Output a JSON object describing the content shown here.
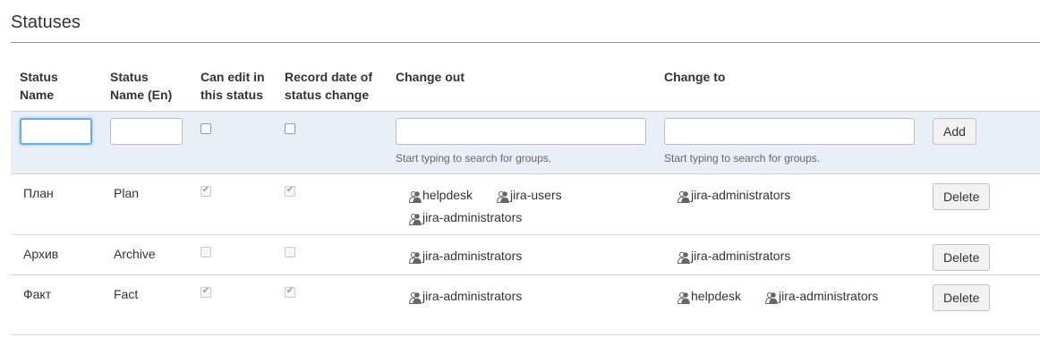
{
  "page": {
    "title": "Statuses"
  },
  "table": {
    "headers": {
      "status_name": "Status Name",
      "status_name_en": "Status Name (En)",
      "can_edit": "Can edit in this status",
      "record_date": "Record date of status change",
      "change_out": "Change out",
      "change_to": "Change to"
    },
    "add_row": {
      "status_name_value": "",
      "status_name_en_value": "",
      "can_edit_checked": false,
      "record_date_checked": false,
      "change_out_value": "",
      "change_to_value": "",
      "change_out_hint": "Start typing to search for groups.",
      "change_to_hint": "Start typing to search for groups.",
      "add_label": "Add"
    },
    "rows": [
      {
        "name": "План",
        "name_en": "Plan",
        "can_edit": true,
        "record_date": true,
        "change_out": [
          "helpdesk",
          "jira-users",
          "jira-administrators"
        ],
        "change_to": [
          "jira-administrators"
        ],
        "delete_label": "Delete"
      },
      {
        "name": "Архив",
        "name_en": "Archive",
        "can_edit": false,
        "record_date": false,
        "change_out": [
          "jira-administrators"
        ],
        "change_to": [
          "jira-administrators"
        ],
        "delete_label": "Delete"
      },
      {
        "name": "Факт",
        "name_en": "Fact",
        "can_edit": true,
        "record_date": true,
        "change_out": [
          "jira-administrators"
        ],
        "change_to": [
          "helpdesk",
          "jira-administrators"
        ],
        "delete_label": "Delete"
      }
    ]
  },
  "icons": {
    "group": "user-group-icon"
  },
  "colors": {
    "add_row_bg": "#e8eff7",
    "focus_ring": "#66aaf0"
  }
}
